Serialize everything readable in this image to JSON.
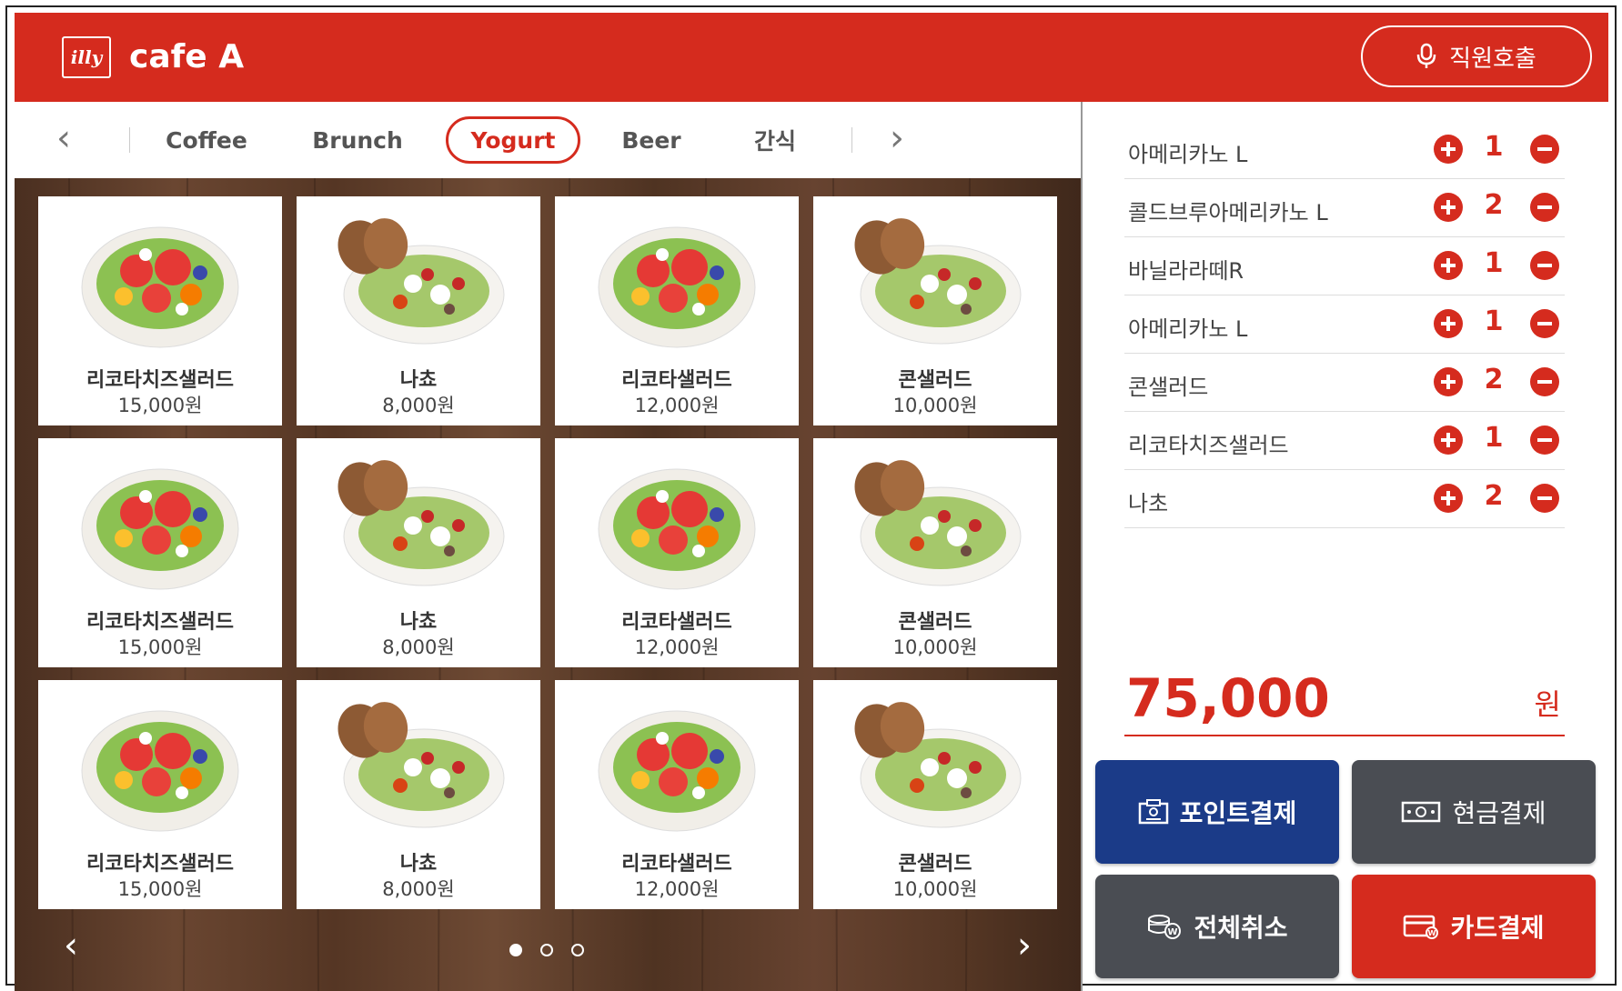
{
  "header": {
    "logo_text": "illy",
    "brand": "cafe A",
    "call_staff": "직원호출"
  },
  "categories": {
    "tabs": [
      "Coffee",
      "Brunch",
      "Yogurt",
      "Beer",
      "간식"
    ],
    "active": "Yogurt",
    "prev_icon": "chevron-left-icon",
    "next_icon": "chevron-right-icon"
  },
  "menu": {
    "items": [
      {
        "name": "리코타치즈샐러드",
        "price": "15,000원",
        "image": "salad"
      },
      {
        "name": "나쵸",
        "price": "8,000원",
        "image": "bread-salad"
      },
      {
        "name": "리코타샐러드",
        "price": "12,000원",
        "image": "salad"
      },
      {
        "name": "콘샐러드",
        "price": "10,000원",
        "image": "bread-salad"
      },
      {
        "name": "리코타치즈샐러드",
        "price": "15,000원",
        "image": "salad"
      },
      {
        "name": "나쵸",
        "price": "8,000원",
        "image": "bread-salad"
      },
      {
        "name": "리코타샐러드",
        "price": "12,000원",
        "image": "salad"
      },
      {
        "name": "콘샐러드",
        "price": "10,000원",
        "image": "bread-salad"
      },
      {
        "name": "리코타치즈샐러드",
        "price": "15,000원",
        "image": "salad"
      },
      {
        "name": "나쵸",
        "price": "8,000원",
        "image": "bread-salad"
      },
      {
        "name": "리코타샐러드",
        "price": "12,000원",
        "image": "salad"
      },
      {
        "name": "콘샐러드",
        "price": "10,000원",
        "image": "bread-salad"
      }
    ],
    "page_current": 1,
    "page_count": 3
  },
  "order": {
    "items": [
      {
        "name": "아메리카노 L",
        "qty": "1"
      },
      {
        "name": "콜드브루아메리카노 L",
        "qty": "2"
      },
      {
        "name": "바닐라라떼R",
        "qty": "1"
      },
      {
        "name": "아메리카노 L",
        "qty": "1"
      },
      {
        "name": "콘샐러드",
        "qty": "2"
      },
      {
        "name": "리코타치즈샐러드",
        "qty": "1"
      },
      {
        "name": "나초",
        "qty": "2"
      }
    ],
    "total": "75,000",
    "currency": "원"
  },
  "payment": {
    "point": "포인트결제",
    "cash": "현금결제",
    "cancel_all": "전체취소",
    "card": "카드결제"
  },
  "colors": {
    "brand_red": "#d52b1e",
    "point_blue": "#1b3b88",
    "dark_gray": "#4a4d53",
    "wood": "#5b3a26"
  }
}
